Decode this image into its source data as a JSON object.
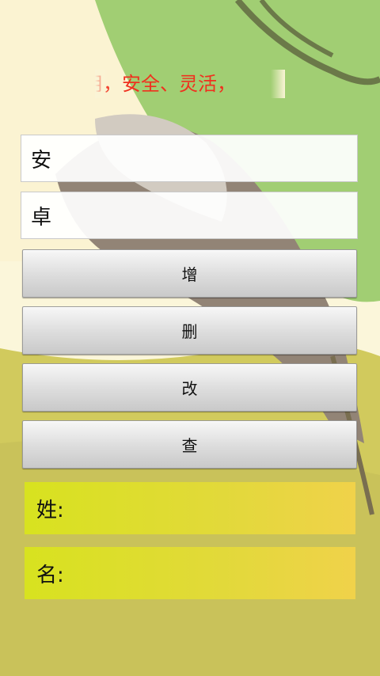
{
  "marquee_text": "用，安全、灵活，",
  "inputs": [
    {
      "value": "安"
    },
    {
      "value": "卓"
    }
  ],
  "buttons": [
    {
      "label": "增"
    },
    {
      "label": "删"
    },
    {
      "label": "改"
    },
    {
      "label": "查"
    }
  ],
  "results": {
    "surname_label": "姓:",
    "name_label": "名:"
  },
  "colors": {
    "marquee": "#f0301e",
    "panel": "#e0dc30"
  }
}
